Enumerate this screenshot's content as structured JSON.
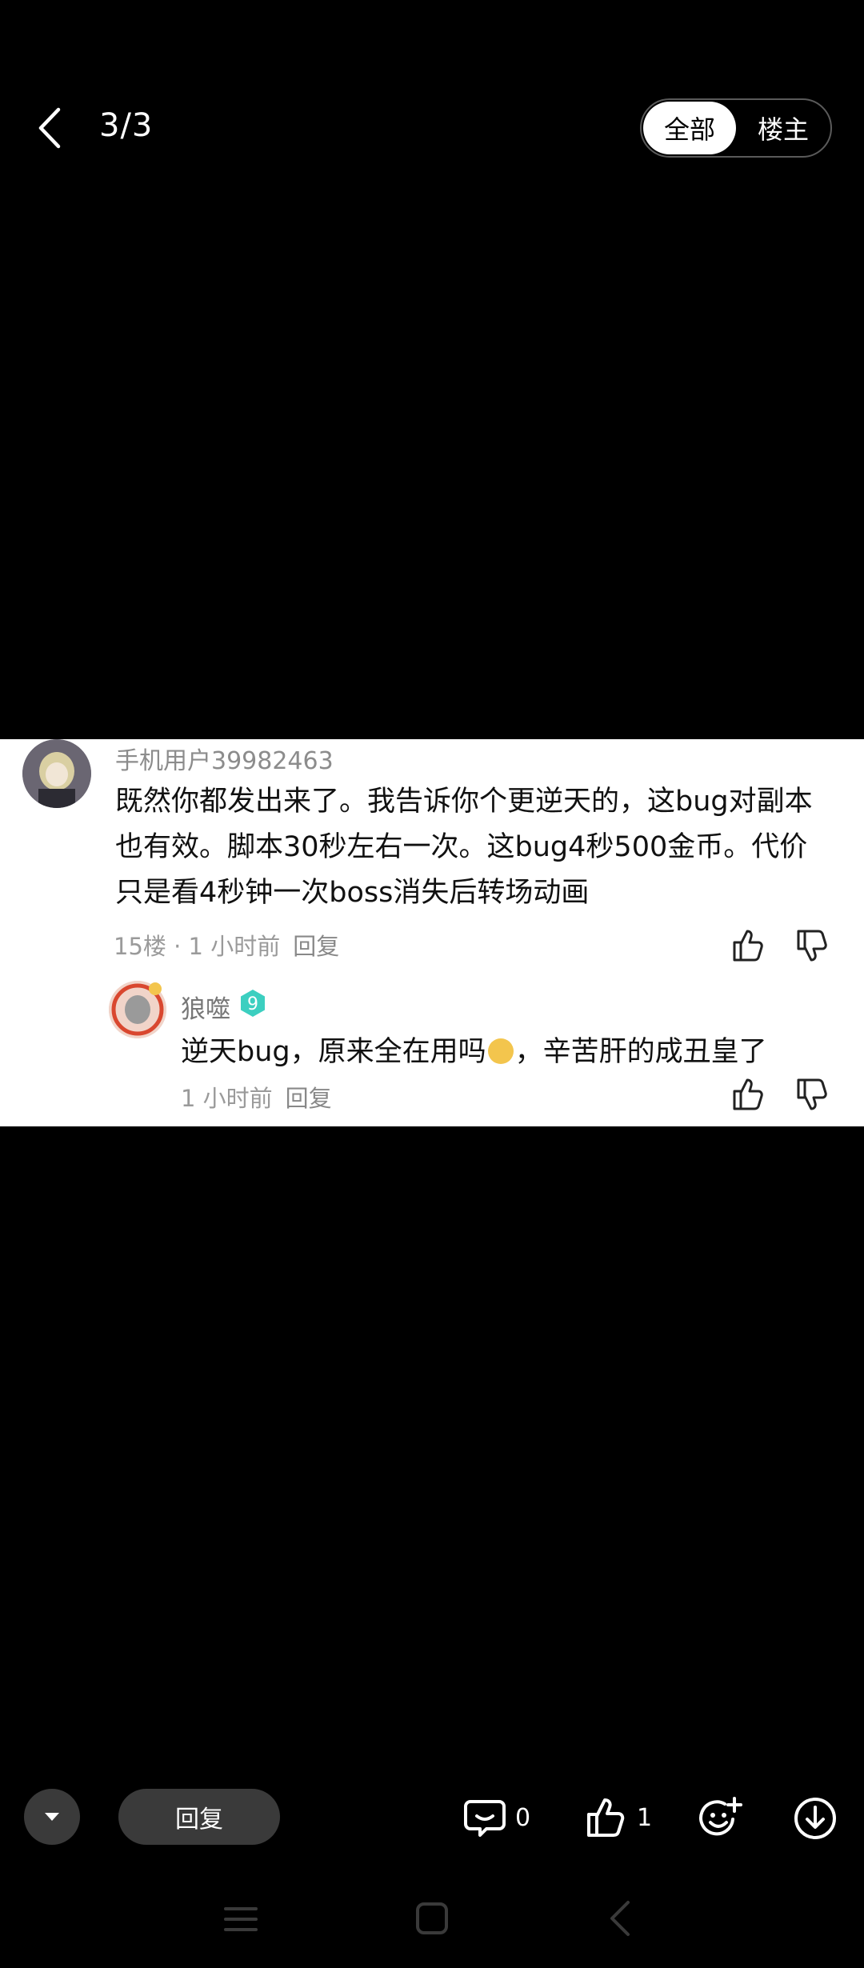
{
  "header": {
    "page_counter": "3/3",
    "filter_all": "全部",
    "filter_op": "楼主"
  },
  "comment": {
    "username": "手机用户39982463",
    "text": "既然你都发出来了。我告诉你个更逆天的，这bug对副本也有效。脚本30秒左右一次。这bug4秒500金币。代价只是看4秒钟一次boss消失后转场动画",
    "floor_time": "15楼 · 1 小时前",
    "reply_label": "回复"
  },
  "sub_reply": {
    "username": "狼噬",
    "level": "9",
    "text_before": "逆天bug，原来全在用吗",
    "text_after": "，辛苦肝的成丑皇了",
    "time": "1 小时前",
    "reply_label": "回复"
  },
  "bottom_bar": {
    "reply_button": "回复",
    "comment_count": "0",
    "like_count": "1"
  },
  "colors": {
    "background": "#000000",
    "card": "#ffffff",
    "badge": "#3ccfc0",
    "pill": "#3a3a3a"
  }
}
